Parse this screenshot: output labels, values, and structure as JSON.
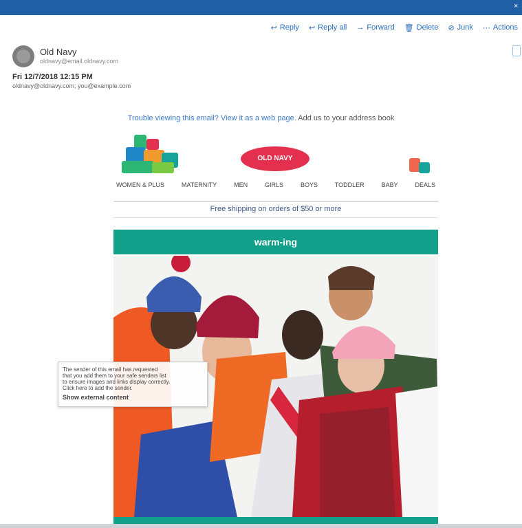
{
  "window": {
    "close_glyph": "×"
  },
  "toolbar": {
    "items": [
      {
        "icon": "reply-icon",
        "glyph": "↩",
        "label": "Reply"
      },
      {
        "icon": "reply-all-icon",
        "glyph": "↩",
        "label": "Reply all"
      },
      {
        "icon": "forward-icon",
        "glyph": "→",
        "label": "Forward"
      },
      {
        "icon": "delete-icon",
        "glyph": "🗑",
        "label": "Delete"
      },
      {
        "icon": "junk-icon",
        "glyph": "⊘",
        "label": "Junk"
      },
      {
        "icon": "more-icon",
        "glyph": "⋯",
        "label": "Actions"
      }
    ]
  },
  "sender": {
    "name": "Old Navy",
    "email": "oldnavy@email.oldnavy.com",
    "date": "Fri 12/7/2018 12:15 PM",
    "to": "oldnavy@oldnavy.com; you@example.com"
  },
  "preview": {
    "link_text": "Trouble viewing this email? View it as a web page.",
    "rest_text": "Add us to your address book"
  },
  "email": {
    "logo_pill_text": "OLD NAVY",
    "nav": [
      "WOMEN & PLUS",
      "MATERNITY",
      "MEN",
      "GIRLS",
      "BOYS",
      "TODDLER",
      "BABY",
      "DEALS"
    ],
    "ship_text": "Free shipping on orders of $50 or more",
    "banner_text": "warm-ing"
  },
  "tooltip": {
    "lines": [
      "The sender of this email has requested",
      "that you add them to your safe senders list",
      "to ensure images and links display correctly.",
      "Click here to add the sender."
    ],
    "strong": "Show external content"
  },
  "colors": {
    "titlebar": "#1f5fa3",
    "link": "#2a6ebb",
    "teal": "#12a08a",
    "brand_red": "#e2304e"
  }
}
